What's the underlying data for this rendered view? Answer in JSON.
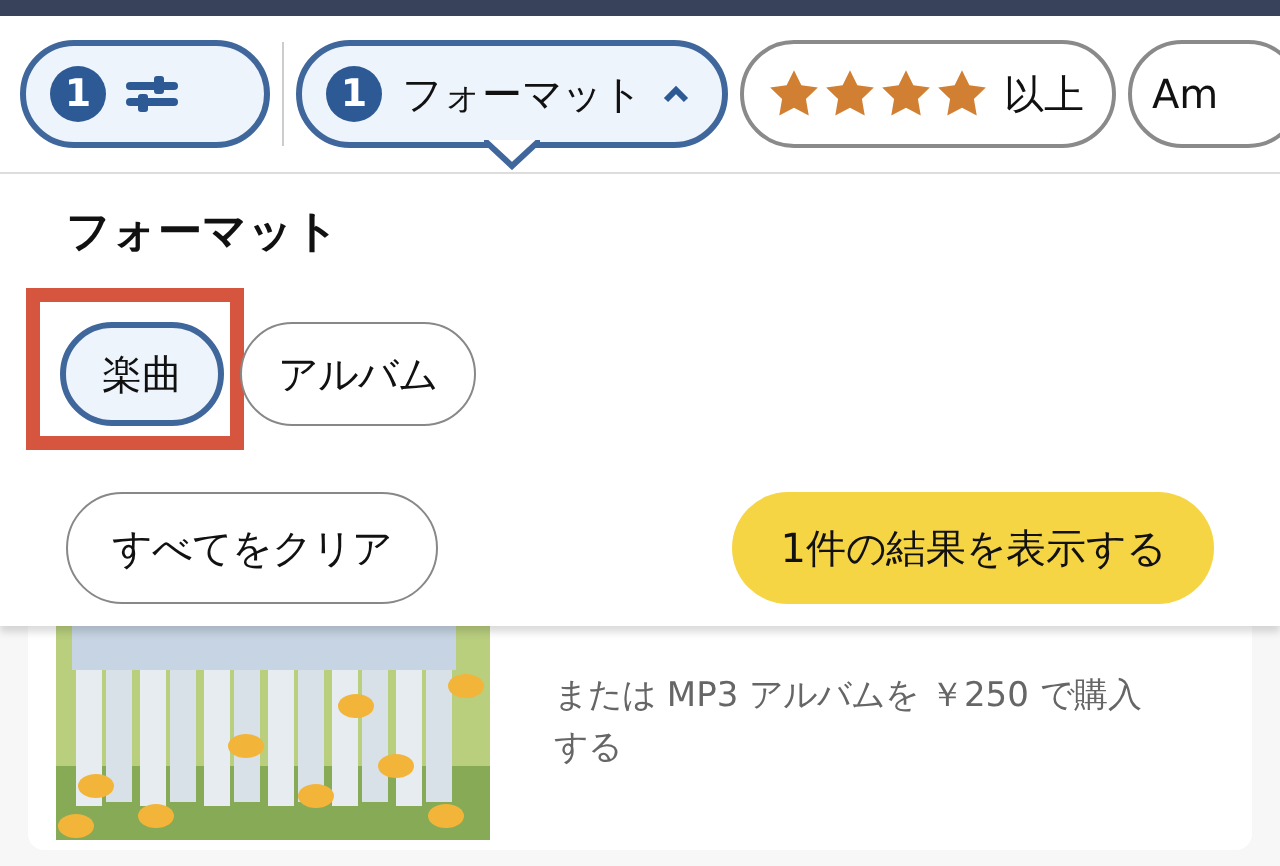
{
  "filter_bar": [
    {
      "kind": "filters",
      "count": "1",
      "selected": true
    },
    {
      "kind": "dropdown",
      "count": "1",
      "label": "フォーマット",
      "selected": true,
      "expanded": true
    },
    {
      "kind": "rating",
      "stars": 4,
      "label": "以上",
      "selected": false
    },
    {
      "kind": "text",
      "label": "Am",
      "selected": false
    }
  ],
  "panel": {
    "title": "フォーマット",
    "options": [
      {
        "label": "楽曲",
        "selected": true,
        "highlighted": true
      },
      {
        "label": "アルバム",
        "selected": false,
        "highlighted": false
      }
    ],
    "clear_button": "すべてをクリア",
    "show_results_button": "1件の結果を表示する"
  },
  "result": {
    "price_text": "または MP3 アルバムを ￥250 で購入する"
  }
}
